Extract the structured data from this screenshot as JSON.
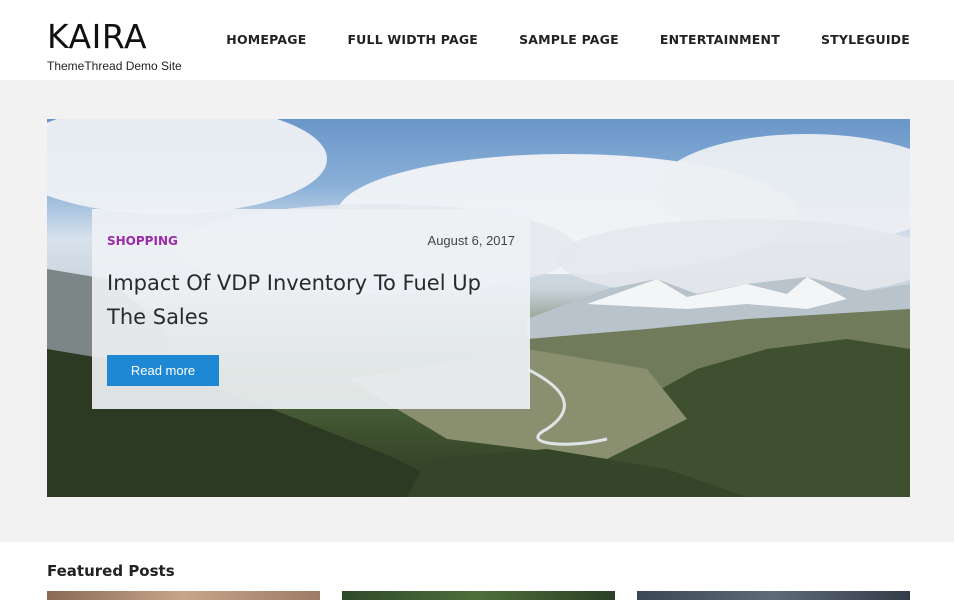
{
  "header": {
    "site_title": "KAIRA",
    "tagline": "ThemeThread Demo Site",
    "nav": [
      "HOMEPAGE",
      "FULL WIDTH PAGE",
      "SAMPLE PAGE",
      "ENTERTAINMENT",
      "STYLEGUIDE"
    ]
  },
  "hero": {
    "category": "SHOPPING",
    "date": "August 6, 2017",
    "title": "Impact Of VDP Inventory To Fuel Up The Sales",
    "button_label": "Read more"
  },
  "featured": {
    "heading": "Featured Posts"
  },
  "colors": {
    "accent_button": "#1e88d4",
    "category": "#9b2aa8",
    "band_background": "#f2f2f2"
  }
}
